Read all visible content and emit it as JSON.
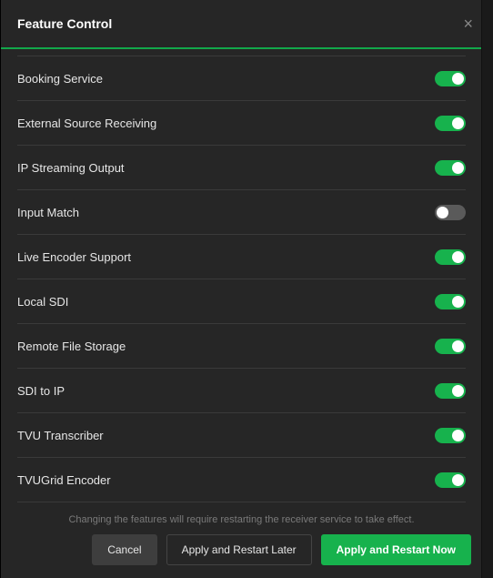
{
  "header": {
    "title": "Feature Control",
    "close_icon": "×"
  },
  "features": [
    {
      "name": "booking-service",
      "label": "Booking Service",
      "on": true
    },
    {
      "name": "external-source-receiving",
      "label": "External Source Receiving",
      "on": true
    },
    {
      "name": "ip-streaming-output",
      "label": "IP Streaming Output",
      "on": true
    },
    {
      "name": "input-match",
      "label": "Input Match",
      "on": false
    },
    {
      "name": "live-encoder-support",
      "label": "Live Encoder Support",
      "on": true
    },
    {
      "name": "local-sdi",
      "label": "Local SDI",
      "on": true
    },
    {
      "name": "remote-file-storage",
      "label": "Remote File Storage",
      "on": true
    },
    {
      "name": "sdi-to-ip",
      "label": "SDI to IP",
      "on": true
    },
    {
      "name": "tvu-transcriber",
      "label": "TVU Transcriber",
      "on": true
    },
    {
      "name": "tvugrid-encoder",
      "label": "TVUGrid Encoder",
      "on": true
    }
  ],
  "footer": {
    "note": "Changing the features will require restarting the receiver service to take effect.",
    "cancel": "Cancel",
    "apply_later": "Apply and Restart Later",
    "apply_now": "Apply and Restart Now"
  }
}
